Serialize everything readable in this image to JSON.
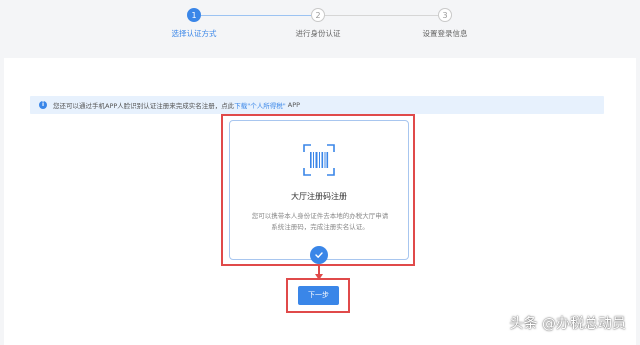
{
  "steps": [
    {
      "number": "1",
      "label": "选择认证方式",
      "state": "active"
    },
    {
      "number": "2",
      "label": "进行身份认证",
      "state": "inactive"
    },
    {
      "number": "3",
      "label": "设置登录信息",
      "state": "inactive"
    }
  ],
  "notice": {
    "text": "您还可以通过手机APP人脸识别认证注册来完成实名注册，点此",
    "link": "下载\"个人所得税\"",
    "suffix": "APP"
  },
  "card": {
    "icon": "barcode-scan-icon",
    "title": "大厅注册码注册",
    "description_line1": "您可以携带本人身份证件去本地的办税大厅申请",
    "description_line2": "系统注册码，完成注册实名认证。"
  },
  "next_button": "下一步",
  "watermark": "头条 @办税总动员",
  "colors": {
    "accent": "#3a86e8",
    "highlight": "#e04a4a",
    "notice_bg": "#e7f1fd"
  }
}
